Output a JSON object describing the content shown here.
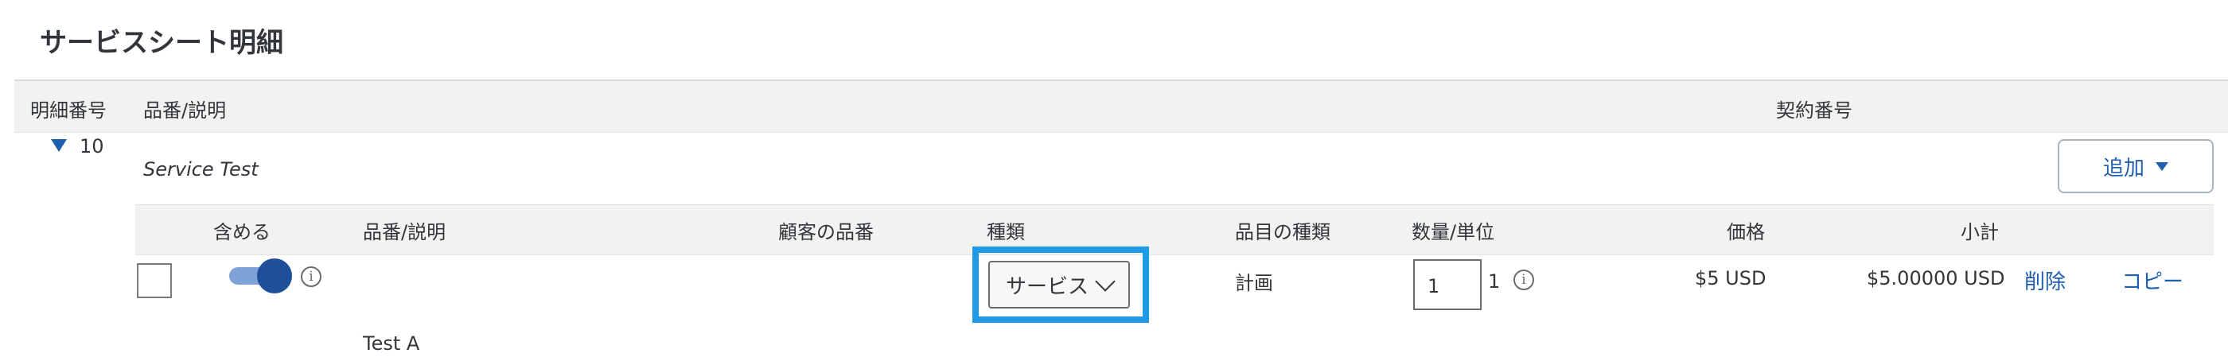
{
  "page_title": "サービスシート明細",
  "header": {
    "line_no": "明細番号",
    "part_desc": "品番/説明",
    "contract_no": "契約番号"
  },
  "line": {
    "number": "10",
    "description": "Service Test",
    "add_button": "追加"
  },
  "sub_header": {
    "include": "含める",
    "part_desc": "品番/説明",
    "customer_part": "顧客の品番",
    "type": "種類",
    "item_type": "品目の種類",
    "qty_unit": "数量/単位",
    "price": "価格",
    "subtotal": "小計"
  },
  "item": {
    "type_value": "サービス",
    "item_type": "計画",
    "quantity": "1",
    "unit": "1",
    "price": "$5 USD",
    "subtotal": "$5.00000 USD",
    "delete": "削除",
    "copy": "コピー",
    "description": "Test A",
    "include_on": true
  },
  "icons": {
    "info": "i",
    "expand": "triangle-down-icon",
    "chevron": "chevron-down-icon"
  },
  "colors": {
    "accent": "#1f5fb0",
    "highlight": "#1f9be6",
    "toggle_track": "#7ea2d8",
    "toggle_knob": "#1e4f9a"
  }
}
